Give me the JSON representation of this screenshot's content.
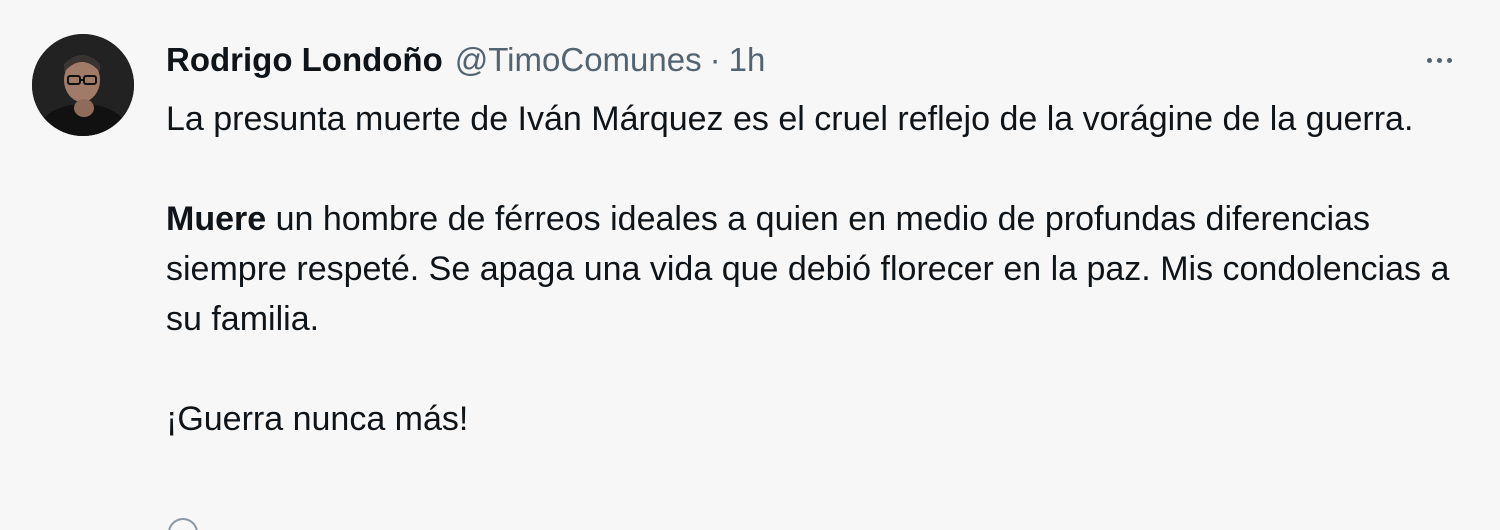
{
  "author": {
    "display_name": "Rodrigo Londoño",
    "handle": "@TimoComunes",
    "separator": "·",
    "time": "1h",
    "avatar_icon": "user-avatar-photo"
  },
  "menu": {
    "more_icon": "more-horizontal-icon"
  },
  "tweet": {
    "paragraph1": "La presunta muerte de Iván Márquez es el cruel reflejo de la vorágine de la guerra.",
    "paragraph2_bold": "Muere",
    "paragraph2_rest": " un hombre de férreos ideales a quien en medio de profundas diferencias siempre respeté. Se apaga una vida que debió florecer en la paz. Mis condolencias a su familia.",
    "paragraph3": "¡Guerra nunca más!"
  },
  "colors": {
    "background": "#f7f7f7",
    "text_primary": "#0f1419",
    "text_secondary": "#536471"
  }
}
